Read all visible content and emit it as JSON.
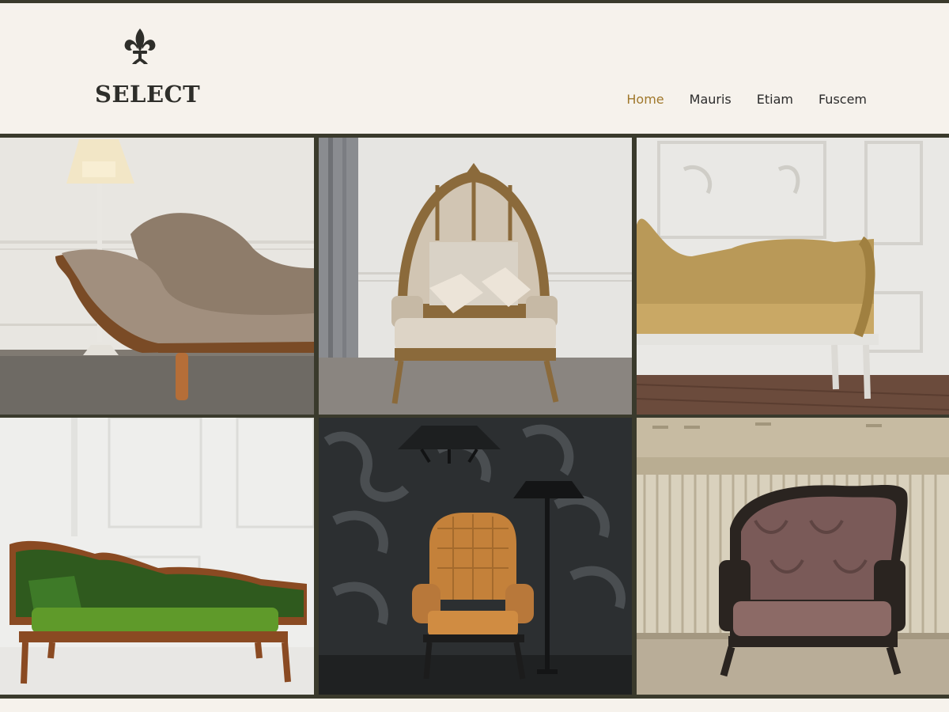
{
  "site": {
    "logo_text": "SELECT",
    "logo_icon": "fleur-de-lis-icon"
  },
  "nav": {
    "items": [
      {
        "label": "Home",
        "active": true
      },
      {
        "label": "Mauris",
        "active": false
      },
      {
        "label": "Etiam",
        "active": false
      },
      {
        "label": "Fuscem",
        "active": false
      }
    ]
  },
  "colors": {
    "accent": "#a0782c",
    "background": "#f6f2ec",
    "border": "#3a3a2c",
    "text": "#2b2b2b"
  },
  "gallery": {
    "tiles": [
      {
        "subject": "tufted chaise longue with floor lamp"
      },
      {
        "subject": "canopy balloon armchair with cushions"
      },
      {
        "subject": "gilded tufted settee"
      },
      {
        "subject": "green velvet carved sofa"
      },
      {
        "subject": "leather wingback chair with lamp"
      },
      {
        "subject": "damask upholstered armchair"
      }
    ]
  }
}
